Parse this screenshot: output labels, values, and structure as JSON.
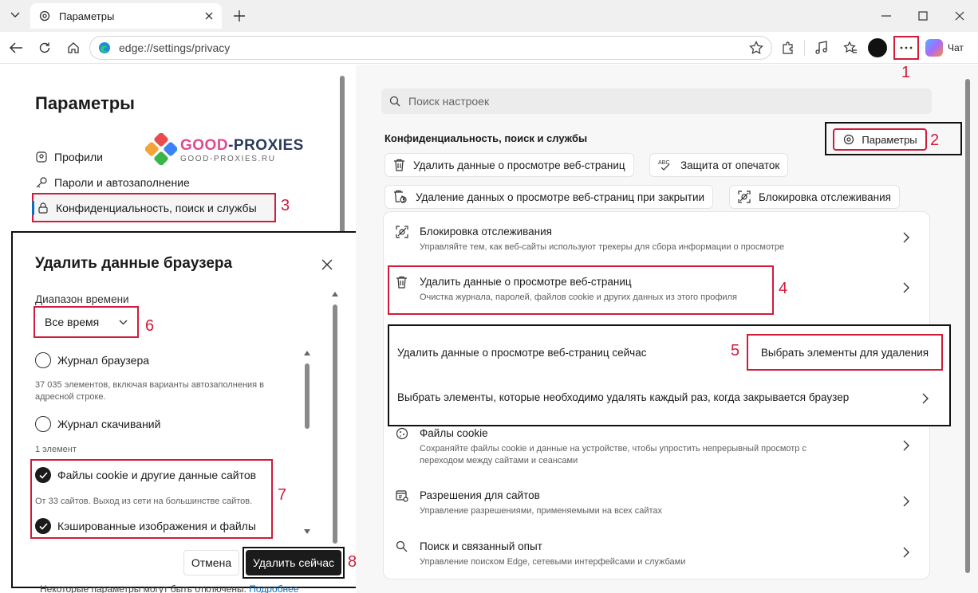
{
  "browser": {
    "tab_title": "Параметры",
    "url": "edge://settings/privacy",
    "chat_label": "Чат"
  },
  "left_nav": {
    "title": "Параметры",
    "items": [
      {
        "label": "Профили",
        "icon": "profile-icon"
      },
      {
        "label": "Пароли и автозаполнение",
        "icon": "key-icon"
      },
      {
        "label": "Конфиденциальность, поиск и службы",
        "icon": "lock-icon"
      }
    ]
  },
  "watermark": {
    "name_colored": "GOOD",
    "name_rest": "-PROXIES",
    "url": "GOOD-PROXIES.RU"
  },
  "dialog": {
    "title": "Удалить данные браузера",
    "range_label": "Диапазон времени",
    "range_value": "Все время",
    "options": [
      {
        "label": "Журнал браузера",
        "checked": false,
        "hint": "37 035 элементов, включая варианты автозаполнения в адресной строке."
      },
      {
        "label": "Журнал скачиваний",
        "checked": false,
        "hint": "1 элемент"
      },
      {
        "label": "Файлы cookie и другие данные сайтов",
        "checked": true,
        "hint": "От 33 сайтов. Выход из сети на большинстве сайтов."
      },
      {
        "label": "Кэшированные изображения и файлы",
        "checked": true,
        "hint": ""
      }
    ],
    "cancel_label": "Отмена",
    "delete_label": "Удалить сейчас"
  },
  "footer": {
    "note": "Некоторые параметры могут быть отключены.",
    "link": "Подробнее"
  },
  "right": {
    "search_placeholder": "Поиск настроек",
    "section_title": "Конфиденциальность, поиск и службы",
    "params_button": "Параметры",
    "chips": [
      {
        "label": "Удалить данные о просмотре веб-страниц",
        "icon": "trash-icon"
      },
      {
        "label": "Защита от опечаток",
        "icon": "spellcheck-icon"
      },
      {
        "label": "Удаление данных о просмотре веб-страниц при закрытии",
        "icon": "trash-clock-icon"
      },
      {
        "label": "Блокировка отслеживания",
        "icon": "tracking-icon"
      }
    ],
    "rows": [
      {
        "title": "Блокировка отслеживания",
        "subtitle": "Управляйте тем, как веб-сайты используют трекеры для сбора информации о просмотре"
      },
      {
        "title": "Удалить данные о просмотре веб-страниц",
        "subtitle": "Очистка журнала, паролей, файлов cookie и других данных из этого профиля"
      },
      {
        "title": "Файлы cookie",
        "subtitle": "Сохраняйте файлы cookie и данные на устройстве, чтобы упростить непрерывный просмотр с переходом между сайтами и сеансами"
      },
      {
        "title": "Разрешения для сайтов",
        "subtitle": "Управление разрешениями, применяемыми на всех сайтах"
      },
      {
        "title": "Поиск и связанный опыт",
        "subtitle": "Управление поиском Edge, сетевыми интерфейсами и службами"
      }
    ],
    "subpanel": {
      "now_label": "Удалить данные о просмотре веб-страниц сейчас",
      "select_button": "Выбрать элементы для удаления",
      "onclose_label": "Выбрать элементы, которые необходимо удалять каждый раз, когда закрывается браузер"
    }
  },
  "annotations": [
    "1",
    "2",
    "3",
    "4",
    "5",
    "6",
    "7",
    "8"
  ],
  "colors": {
    "annotation_red": "#d11b3b",
    "link_blue": "#0f6cbd"
  }
}
